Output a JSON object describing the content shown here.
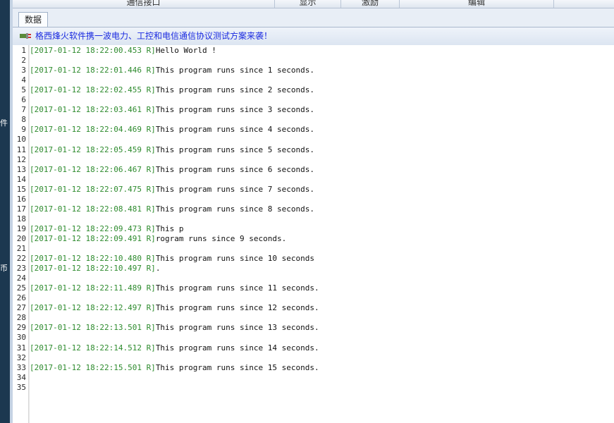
{
  "top_headers": [
    "通信接口",
    "显示",
    "激励",
    "编辑"
  ],
  "left_strip_chars": [
    "件",
    "币"
  ],
  "tab": "数据",
  "banner": "格西烽火软件携一波电力、工控和电信通信协议测试方案来袭！",
  "lines": [
    {
      "n": "1",
      "ts": "[2017-01-12 18:22:00.453 R]",
      "msg": "Hello World !"
    },
    {
      "n": "2",
      "ts": "",
      "msg": ""
    },
    {
      "n": "3",
      "ts": "[2017-01-12 18:22:01.446 R]",
      "msg": "This program runs since 1 seconds."
    },
    {
      "n": "4",
      "ts": "",
      "msg": ""
    },
    {
      "n": "5",
      "ts": "[2017-01-12 18:22:02.455 R]",
      "msg": "This program runs since 2 seconds."
    },
    {
      "n": "6",
      "ts": "",
      "msg": ""
    },
    {
      "n": "7",
      "ts": "[2017-01-12 18:22:03.461 R]",
      "msg": "This program runs since 3 seconds."
    },
    {
      "n": "8",
      "ts": "",
      "msg": ""
    },
    {
      "n": "9",
      "ts": "[2017-01-12 18:22:04.469 R]",
      "msg": "This program runs since 4 seconds."
    },
    {
      "n": "10",
      "ts": "",
      "msg": ""
    },
    {
      "n": "11",
      "ts": "[2017-01-12 18:22:05.459 R]",
      "msg": "This program runs since 5 seconds."
    },
    {
      "n": "12",
      "ts": "",
      "msg": ""
    },
    {
      "n": "13",
      "ts": "[2017-01-12 18:22:06.467 R]",
      "msg": "This program runs since 6 seconds."
    },
    {
      "n": "14",
      "ts": "",
      "msg": ""
    },
    {
      "n": "15",
      "ts": "[2017-01-12 18:22:07.475 R]",
      "msg": "This program runs since 7 seconds."
    },
    {
      "n": "16",
      "ts": "",
      "msg": ""
    },
    {
      "n": "17",
      "ts": "[2017-01-12 18:22:08.481 R]",
      "msg": "This program runs since 8 seconds."
    },
    {
      "n": "18",
      "ts": "",
      "msg": ""
    },
    {
      "n": "19",
      "ts": "[2017-01-12 18:22:09.473 R]",
      "msg": "This p"
    },
    {
      "n": "20",
      "ts": "[2017-01-12 18:22:09.491 R]",
      "msg": "rogram runs since 9 seconds."
    },
    {
      "n": "21",
      "ts": "",
      "msg": ""
    },
    {
      "n": "22",
      "ts": "[2017-01-12 18:22:10.480 R]",
      "msg": "This program runs since 10 seconds"
    },
    {
      "n": "23",
      "ts": "[2017-01-12 18:22:10.497 R]",
      "msg": "."
    },
    {
      "n": "24",
      "ts": "",
      "msg": ""
    },
    {
      "n": "25",
      "ts": "[2017-01-12 18:22:11.489 R]",
      "msg": "This program runs since 11 seconds."
    },
    {
      "n": "26",
      "ts": "",
      "msg": ""
    },
    {
      "n": "27",
      "ts": "[2017-01-12 18:22:12.497 R]",
      "msg": "This program runs since 12 seconds."
    },
    {
      "n": "28",
      "ts": "",
      "msg": ""
    },
    {
      "n": "29",
      "ts": "[2017-01-12 18:22:13.501 R]",
      "msg": "This program runs since 13 seconds."
    },
    {
      "n": "30",
      "ts": "",
      "msg": ""
    },
    {
      "n": "31",
      "ts": "[2017-01-12 18:22:14.512 R]",
      "msg": "This program runs since 14 seconds."
    },
    {
      "n": "32",
      "ts": "",
      "msg": ""
    },
    {
      "n": "33",
      "ts": "[2017-01-12 18:22:15.501 R]",
      "msg": "This program runs since 15 seconds."
    },
    {
      "n": "34",
      "ts": "",
      "msg": ""
    },
    {
      "n": "35",
      "ts": "",
      "msg": ""
    }
  ]
}
